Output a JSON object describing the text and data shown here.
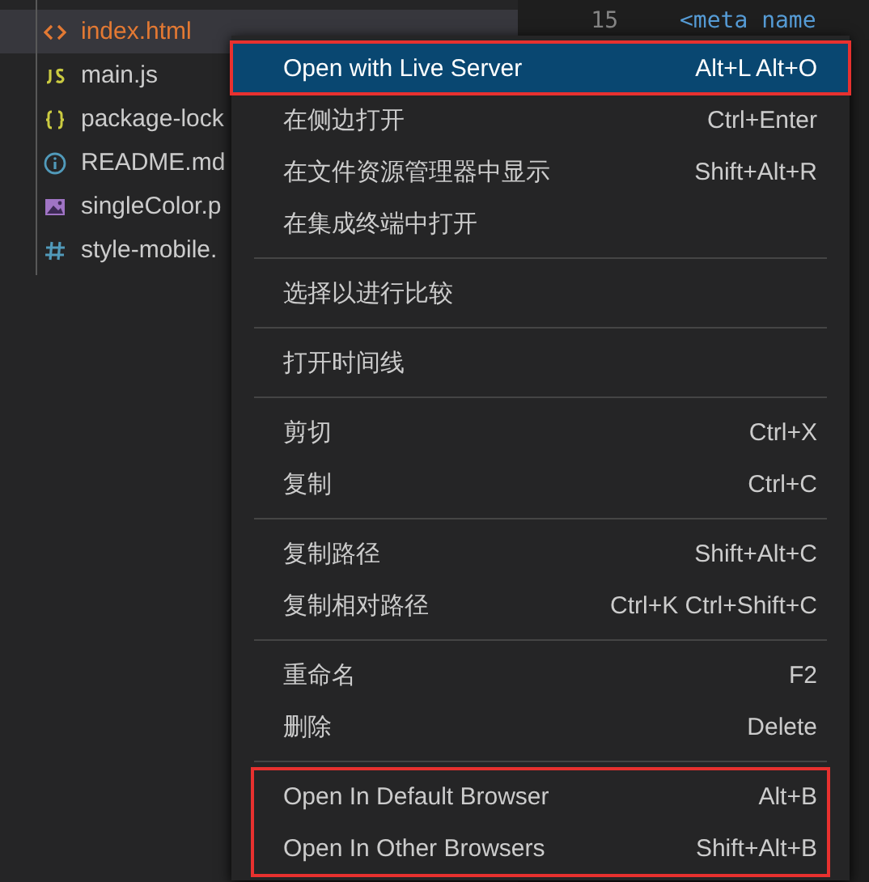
{
  "explorer": {
    "files": [
      {
        "name": "index.html",
        "kind": "html",
        "selected": true
      },
      {
        "name": "main.js",
        "kind": "js",
        "selected": false
      },
      {
        "name": "package-lock",
        "kind": "json",
        "selected": false
      },
      {
        "name": "README.md",
        "kind": "info",
        "selected": false
      },
      {
        "name": "singleColor.p",
        "kind": "image",
        "selected": false
      },
      {
        "name": "style-mobile.",
        "kind": "css",
        "selected": false
      }
    ]
  },
  "editor": {
    "line_number": "15",
    "code": "<meta name"
  },
  "context_menu": {
    "groups": [
      {
        "framed": false,
        "items": [
          {
            "label": "Open with Live Server",
            "shortcut": "Alt+L Alt+O",
            "selected": true,
            "framed": true
          },
          {
            "label": "在侧边打开",
            "shortcut": "Ctrl+Enter",
            "selected": false,
            "framed": false
          },
          {
            "label": "在文件资源管理器中显示",
            "shortcut": "Shift+Alt+R",
            "selected": false,
            "framed": false
          },
          {
            "label": "在集成终端中打开",
            "selected": false,
            "framed": false
          }
        ]
      },
      {
        "framed": false,
        "items": [
          {
            "label": "选择以进行比较",
            "selected": false,
            "framed": false
          }
        ]
      },
      {
        "framed": false,
        "items": [
          {
            "label": "打开时间线",
            "selected": false,
            "framed": false
          }
        ]
      },
      {
        "framed": false,
        "items": [
          {
            "label": "剪切",
            "shortcut": "Ctrl+X",
            "selected": false,
            "framed": false
          },
          {
            "label": "复制",
            "shortcut": "Ctrl+C",
            "selected": false,
            "framed": false
          }
        ]
      },
      {
        "framed": false,
        "items": [
          {
            "label": "复制路径",
            "shortcut": "Shift+Alt+C",
            "selected": false,
            "framed": false
          },
          {
            "label": "复制相对路径",
            "shortcut": "Ctrl+K Ctrl+Shift+C",
            "selected": false,
            "framed": false
          }
        ]
      },
      {
        "framed": false,
        "items": [
          {
            "label": "重命名",
            "shortcut": "F2",
            "selected": false,
            "framed": false
          },
          {
            "label": "删除",
            "shortcut": "Delete",
            "selected": false,
            "framed": false
          }
        ]
      },
      {
        "framed": true,
        "items": [
          {
            "label": "Open In Default Browser",
            "shortcut": "Alt+B",
            "selected": false,
            "framed": false
          },
          {
            "label": "Open In Other Browsers",
            "shortcut": "Shift+Alt+B",
            "selected": false,
            "framed": false
          }
        ]
      }
    ]
  }
}
